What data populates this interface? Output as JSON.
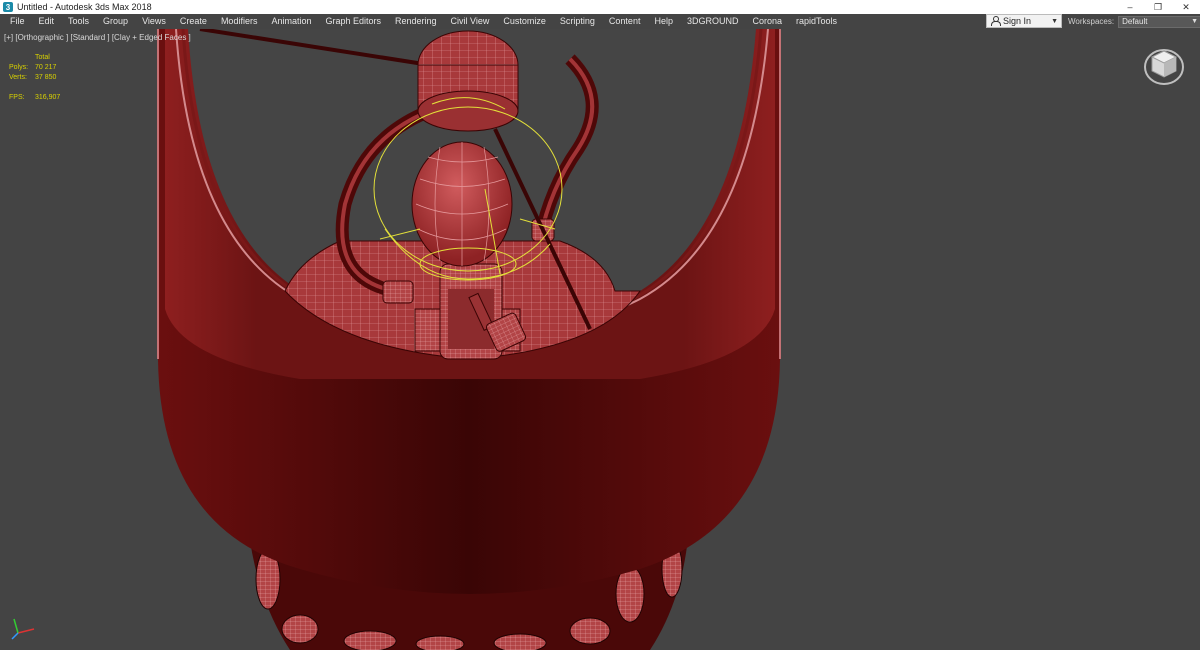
{
  "window": {
    "title": "Untitled - Autodesk 3ds Max 2018",
    "icon": "app-icon",
    "controls": {
      "minimize": "–",
      "restore": "❐",
      "close": "✕"
    }
  },
  "menu": {
    "items": [
      "File",
      "Edit",
      "Tools",
      "Group",
      "Views",
      "Create",
      "Modifiers",
      "Animation",
      "Graph Editors",
      "Rendering",
      "Civil View",
      "Customize",
      "Scripting",
      "Content",
      "Help",
      "3DGROUND",
      "Corona",
      "rapidTools"
    ],
    "signin_label": "Sign In",
    "workspaces_label": "Workspaces:",
    "workspaces_value": "Default"
  },
  "viewport": {
    "label": "[+] [Orthographic ] [Standard ] [Clay + Edged Faces ]",
    "stats": {
      "total_label": "Total",
      "polys_label": "Polys:",
      "polys_value": "70 217",
      "verts_label": "Verts:",
      "verts_value": "37 850",
      "fps_label": "FPS:",
      "fps_value": "316,907"
    },
    "colors": {
      "background": "#444444",
      "mesh": "#8a1f1f",
      "mesh_dark": "#2a0404",
      "edges": "#d9868a",
      "selection": "#e3e03a",
      "stats_text": "#d9d200"
    }
  }
}
